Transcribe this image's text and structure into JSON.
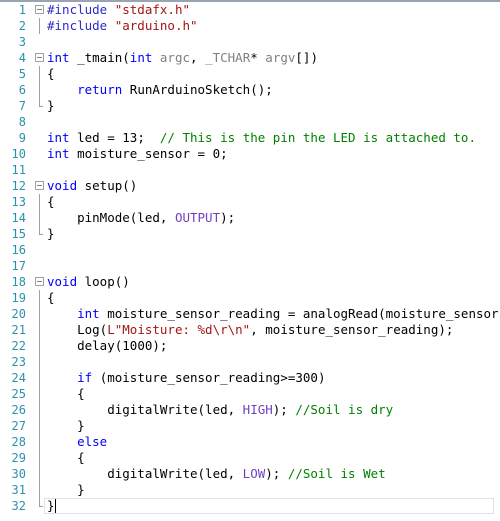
{
  "editor": {
    "language": "cpp",
    "total_lines": 32,
    "caret_line": 32,
    "colors": {
      "background": "#ffffff",
      "line_number": "#2b91af",
      "keyword": "#0000ff",
      "preprocessor": "#2b2bc8",
      "string": "#a31515",
      "comment": "#008000",
      "macro": "#6f42c1",
      "type_gray": "#808080",
      "fold_marker": "#a0a0a0",
      "current_line_border": "#e2e2e5",
      "top_border": "#9aa3b0"
    },
    "lines": [
      {
        "num": "1",
        "fold": "start",
        "tokens": [
          {
            "t": "#include ",
            "c": "pp"
          },
          {
            "t": "\"stdafx.h\"",
            "c": "str"
          }
        ]
      },
      {
        "num": "2",
        "fold": "bar",
        "tokens": [
          {
            "t": "#include ",
            "c": "pp"
          },
          {
            "t": "\"arduino.h\"",
            "c": "str"
          }
        ]
      },
      {
        "num": "3",
        "fold": "none",
        "tokens": []
      },
      {
        "num": "4",
        "fold": "start",
        "tokens": [
          {
            "t": "int",
            "c": "kw"
          },
          {
            "t": " _tmain(",
            "c": "id"
          },
          {
            "t": "int",
            "c": "kw"
          },
          {
            "t": " argc",
            "c": "type"
          },
          {
            "t": ", ",
            "c": "id"
          },
          {
            "t": "_TCHAR",
            "c": "type"
          },
          {
            "t": "* ",
            "c": "id"
          },
          {
            "t": "argv",
            "c": "type"
          },
          {
            "t": "[])",
            "c": "id"
          }
        ]
      },
      {
        "num": "5",
        "fold": "bar",
        "tokens": [
          {
            "t": "{",
            "c": "id"
          }
        ]
      },
      {
        "num": "6",
        "fold": "bar",
        "tokens": [
          {
            "t": "    ",
            "c": "id"
          },
          {
            "t": "return",
            "c": "kw"
          },
          {
            "t": " RunArduinoSketch();",
            "c": "id"
          }
        ]
      },
      {
        "num": "7",
        "fold": "end",
        "tokens": [
          {
            "t": "}",
            "c": "id"
          }
        ]
      },
      {
        "num": "8",
        "fold": "none",
        "tokens": []
      },
      {
        "num": "9",
        "fold": "none",
        "tokens": [
          {
            "t": "int",
            "c": "kw"
          },
          {
            "t": " led = ",
            "c": "id"
          },
          {
            "t": "13",
            "c": "num"
          },
          {
            "t": ";  ",
            "c": "id"
          },
          {
            "t": "// This is the pin the LED is attached to.",
            "c": "cmt"
          }
        ]
      },
      {
        "num": "10",
        "fold": "none",
        "tokens": [
          {
            "t": "int",
            "c": "kw"
          },
          {
            "t": " moisture_sensor = ",
            "c": "id"
          },
          {
            "t": "0",
            "c": "num"
          },
          {
            "t": ";",
            "c": "id"
          }
        ]
      },
      {
        "num": "11",
        "fold": "none",
        "tokens": []
      },
      {
        "num": "12",
        "fold": "start",
        "tokens": [
          {
            "t": "void",
            "c": "kw"
          },
          {
            "t": " setup()",
            "c": "id"
          }
        ]
      },
      {
        "num": "13",
        "fold": "bar",
        "tokens": [
          {
            "t": "{",
            "c": "id"
          }
        ]
      },
      {
        "num": "14",
        "fold": "bar",
        "tokens": [
          {
            "t": "    pinMode(led, ",
            "c": "id"
          },
          {
            "t": "OUTPUT",
            "c": "macro"
          },
          {
            "t": ");",
            "c": "id"
          }
        ]
      },
      {
        "num": "15",
        "fold": "end",
        "tokens": [
          {
            "t": "}",
            "c": "id"
          }
        ]
      },
      {
        "num": "16",
        "fold": "none",
        "tokens": []
      },
      {
        "num": "17",
        "fold": "none",
        "tokens": []
      },
      {
        "num": "18",
        "fold": "start",
        "tokens": [
          {
            "t": "void",
            "c": "kw"
          },
          {
            "t": " loop()",
            "c": "id"
          }
        ]
      },
      {
        "num": "19",
        "fold": "bar",
        "tokens": [
          {
            "t": "{",
            "c": "id"
          }
        ]
      },
      {
        "num": "20",
        "fold": "bar",
        "tokens": [
          {
            "t": "    ",
            "c": "id"
          },
          {
            "t": "int",
            "c": "kw"
          },
          {
            "t": " moisture_sensor_reading = analogRead(moisture_sensor);",
            "c": "id"
          }
        ]
      },
      {
        "num": "21",
        "fold": "bar",
        "tokens": [
          {
            "t": "    Log(",
            "c": "id"
          },
          {
            "t": "L\"Moisture: %d\\r\\n\"",
            "c": "str"
          },
          {
            "t": ", moisture_sensor_reading);",
            "c": "id"
          }
        ]
      },
      {
        "num": "22",
        "fold": "bar",
        "tokens": [
          {
            "t": "    delay(",
            "c": "id"
          },
          {
            "t": "1000",
            "c": "num"
          },
          {
            "t": ");",
            "c": "id"
          }
        ]
      },
      {
        "num": "23",
        "fold": "bar",
        "tokens": []
      },
      {
        "num": "24",
        "fold": "bar",
        "tokens": [
          {
            "t": "    ",
            "c": "id"
          },
          {
            "t": "if",
            "c": "kw"
          },
          {
            "t": " (moisture_sensor_reading>=",
            "c": "id"
          },
          {
            "t": "300",
            "c": "num"
          },
          {
            "t": ")",
            "c": "id"
          }
        ]
      },
      {
        "num": "25",
        "fold": "bar",
        "tokens": [
          {
            "t": "    {",
            "c": "id"
          }
        ]
      },
      {
        "num": "26",
        "fold": "bar",
        "tokens": [
          {
            "t": "        digitalWrite(led, ",
            "c": "id"
          },
          {
            "t": "HIGH",
            "c": "macro"
          },
          {
            "t": "); ",
            "c": "id"
          },
          {
            "t": "//Soil is dry",
            "c": "cmt"
          }
        ]
      },
      {
        "num": "27",
        "fold": "bar",
        "tokens": [
          {
            "t": "    }",
            "c": "id"
          }
        ]
      },
      {
        "num": "28",
        "fold": "bar",
        "tokens": [
          {
            "t": "    ",
            "c": "id"
          },
          {
            "t": "else",
            "c": "kw"
          }
        ]
      },
      {
        "num": "29",
        "fold": "bar",
        "tokens": [
          {
            "t": "    {",
            "c": "id"
          }
        ]
      },
      {
        "num": "30",
        "fold": "bar",
        "tokens": [
          {
            "t": "        digitalWrite(led, ",
            "c": "id"
          },
          {
            "t": "LOW",
            "c": "macro"
          },
          {
            "t": "); ",
            "c": "id"
          },
          {
            "t": "//Soil is Wet",
            "c": "cmt"
          }
        ]
      },
      {
        "num": "31",
        "fold": "bar",
        "tokens": [
          {
            "t": "    }",
            "c": "id"
          }
        ]
      },
      {
        "num": "32",
        "fold": "end",
        "tokens": [
          {
            "t": "}",
            "c": "id"
          }
        ]
      }
    ]
  }
}
